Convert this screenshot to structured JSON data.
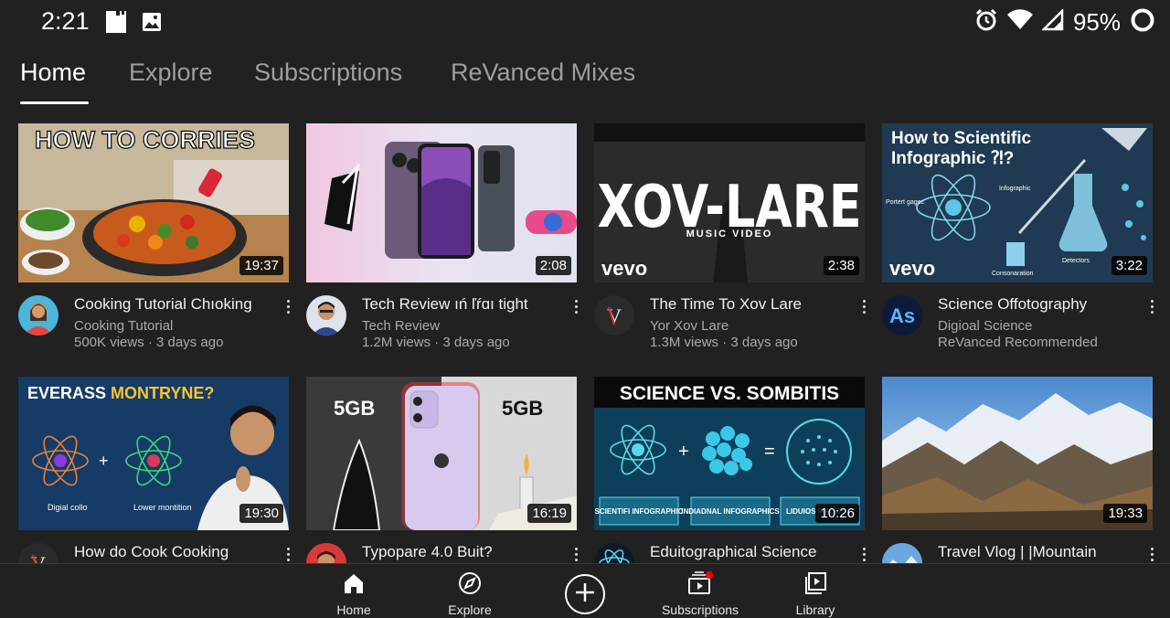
{
  "status_bar": {
    "time": "2:21",
    "battery": "95%",
    "icons": [
      "sd-card-icon",
      "gallery-icon",
      "alarm-icon",
      "wifi-icon",
      "signal-icon",
      "battery-ring-icon"
    ]
  },
  "tabs": [
    {
      "label": "Home",
      "active": true
    },
    {
      "label": "Explore",
      "active": false
    },
    {
      "label": "Subscriptions",
      "active": false
    },
    {
      "label": "ReVanced Mixes",
      "active": false
    }
  ],
  "videos": [
    {
      "thumb_text": "HOW TO CORRIES",
      "duration": "19:37",
      "title": "Cooking Tutorial Chıoking",
      "channel": "Cooking Tutorial",
      "stats": "500K views · 3 days ago"
    },
    {
      "thumb_text": "",
      "duration": "2:08",
      "title": "Tech Review ıń ľŕɑı tight",
      "channel": "Tech Review",
      "stats": "1.2M views · 3 days ago"
    },
    {
      "thumb_text": "XOV-LARE",
      "thumb_sub": "MUSIC VIDEO",
      "thumb_brand": "vevo",
      "duration": "2:38",
      "title": "The Time To Xov Lare",
      "channel": "Yor Xov Lare",
      "stats": "1.3M views · 3 days ago",
      "avatar_letter": "V"
    },
    {
      "thumb_text": "How to Scientific Infographic ⁈?",
      "thumb_brand": "vevo",
      "thumb_labels": [
        "Portert gagec",
        "Infographic",
        "Detectors",
        "Consonaration"
      ],
      "duration": "3:22",
      "title": "Science Offotography",
      "channel": "Digioal Science",
      "stats": "ReVanced Recommended",
      "avatar_letter": "As"
    },
    {
      "thumb_text": "EVERASS",
      "thumb_text_accent": "MONTRYNE?",
      "thumb_labels": [
        "Digial collo",
        "Lower montition"
      ],
      "duration": "19:30",
      "title": "How do Cook Cooking",
      "channel": "",
      "stats": "",
      "avatar_letter": "V"
    },
    {
      "thumb_text": "5GB",
      "thumb_text_right": "5GB",
      "duration": "16:19",
      "title": "Typopare 4.0 Buit?",
      "channel": "",
      "stats": ""
    },
    {
      "thumb_text": "SCIENCE VS. SOMBITIS",
      "thumb_labels": [
        "SCIENTIFI INFOGRAPHIC",
        "INDIADNAL INFOGRAPHICS",
        "LIDUIOS INFOC"
      ],
      "duration": "10:26",
      "title": "Eduitographical Science",
      "channel": "",
      "stats": ""
    },
    {
      "thumb_text": "",
      "duration": "19:33",
      "title": "Travel Vlog | |Mountain",
      "channel": "",
      "stats": ""
    }
  ],
  "bottom_nav": {
    "items": [
      {
        "label": "Home",
        "icon": "home-icon"
      },
      {
        "label": "Explore",
        "icon": "compass-icon"
      },
      {
        "label": "Subscriptions",
        "icon": "subscriptions-icon"
      },
      {
        "label": "Library",
        "icon": "library-icon"
      }
    ],
    "create_icon": "plus-circle-icon"
  },
  "colors": {
    "background": "#212121",
    "accent_red": "#ff0000",
    "text_primary": "#f1f1f1",
    "text_secondary": "#aaaaaa"
  }
}
